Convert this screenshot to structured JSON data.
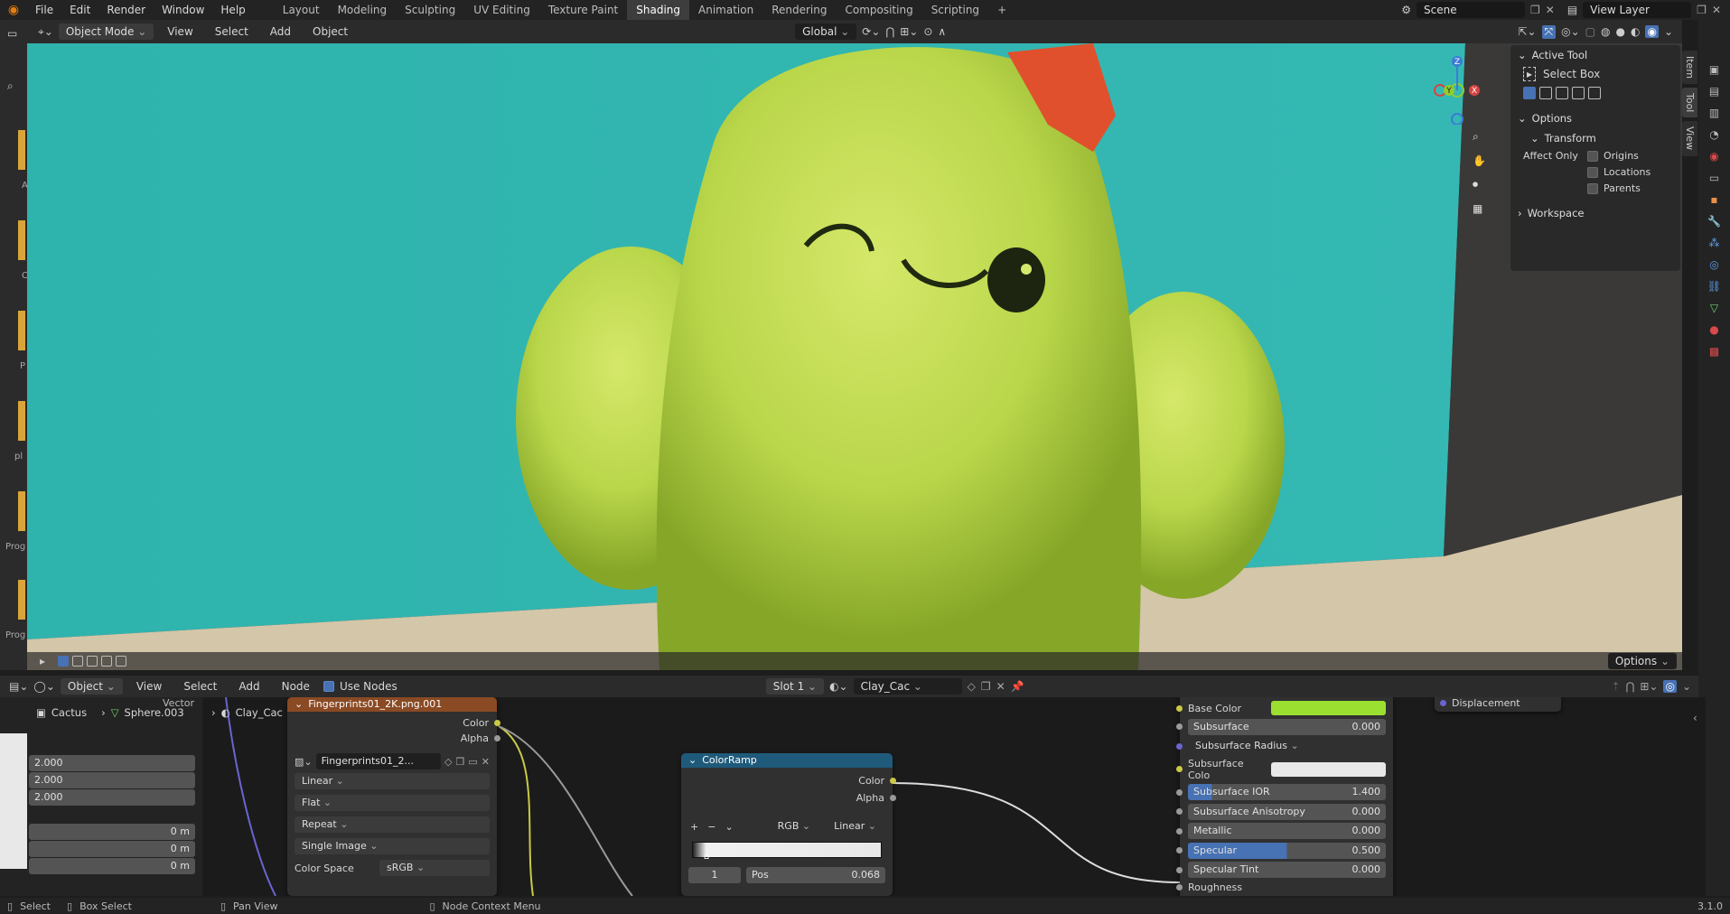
{
  "topbar": {
    "menus": [
      "File",
      "Edit",
      "Render",
      "Window",
      "Help"
    ],
    "workspaces": [
      "Layout",
      "Modeling",
      "Sculpting",
      "UV Editing",
      "Texture Paint",
      "Shading",
      "Animation",
      "Rendering",
      "Compositing",
      "Scripting"
    ],
    "active_workspace": "Shading",
    "scene": "Scene",
    "view_layer": "View Layer"
  },
  "viewport_header": {
    "mode": "Object Mode",
    "menus": [
      "View",
      "Select",
      "Add",
      "Object"
    ],
    "transform_orientation": "Global"
  },
  "npanel": {
    "active_tool_title": "Active Tool",
    "tool_name": "Select Box",
    "options_title": "Options",
    "transform_title": "Transform",
    "affect_only": "Affect Only",
    "origins": "Origins",
    "locations": "Locations",
    "parents": "Parents",
    "workspace_title": "Workspace",
    "tabs": [
      "Item",
      "Tool",
      "View"
    ]
  },
  "left_labels": [
    "A",
    "C",
    "P",
    "pl",
    "Prog",
    "Prog"
  ],
  "viewport_footer": {
    "options": "Options"
  },
  "node_header": {
    "editor": "Object",
    "menus": [
      "View",
      "Select",
      "Add",
      "Node"
    ],
    "use_nodes": "Use Nodes",
    "slot": "Slot 1",
    "material": "Clay_Cac"
  },
  "breadcrumb": {
    "object": "Cactus",
    "mesh": "Sphere.003",
    "material": "Clay_Cac"
  },
  "side_values": [
    "2.000",
    "2.000",
    "2.000",
    "0 m",
    "0 m",
    "0 m"
  ],
  "vector_label": "Vector",
  "image_node": {
    "title": "Fingerprints01_2K.png.001",
    "out_color": "Color",
    "out_alpha": "Alpha",
    "image_name": "Fingerprints01_2...",
    "interpolation": "Linear",
    "projection": "Flat",
    "extension": "Repeat",
    "source": "Single Image",
    "color_space_label": "Color Space",
    "color_space": "sRGB"
  },
  "colorramp": {
    "title": "ColorRamp",
    "out_color": "Color",
    "out_alpha": "Alpha",
    "mode": "RGB",
    "interpolation": "Linear",
    "index": "1",
    "pos_label": "Pos",
    "pos_value": "0.068"
  },
  "bsdf": {
    "base_color": "Base Color",
    "subsurface": "Subsurface",
    "subsurface_val": "0.000",
    "subsurface_radius": "Subsurface Radius",
    "subsurface_color": "Subsurface Colo",
    "subsurface_ior": "Subsurface IOR",
    "subsurface_ior_val": "1.400",
    "subsurface_aniso": "Subsurface Anisotropy",
    "subsurface_aniso_val": "0.000",
    "metallic": "Metallic",
    "metallic_val": "0.000",
    "specular": "Specular",
    "specular_val": "0.500",
    "specular_tint": "Specular Tint",
    "specular_tint_val": "0.000",
    "roughness": "Roughness",
    "displacement": "Displacement"
  },
  "statusbar": {
    "select": "Select",
    "box_select": "Box Select",
    "pan_view": "Pan View",
    "context_menu": "Node Context Menu",
    "version": "3.1.0"
  },
  "colors": {
    "base_color": "#9be030",
    "subsurface_color": "#e8e8e8",
    "accent": "#4772b3",
    "image_header": "#8a4a24",
    "ramp_header": "#1f5a7a"
  }
}
